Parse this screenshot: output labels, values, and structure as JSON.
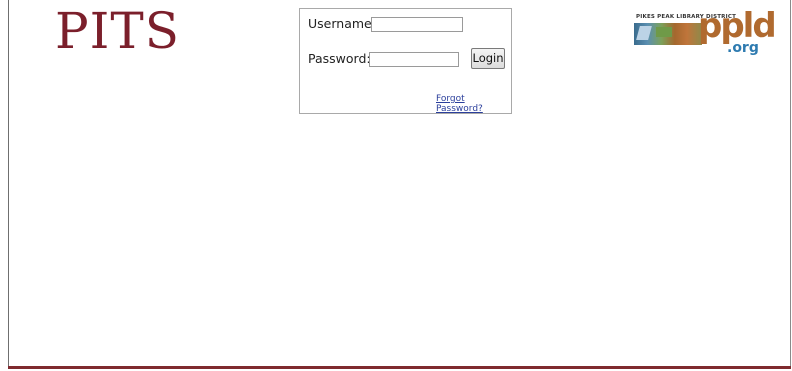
{
  "header": {
    "logo_text": "PITS",
    "partner_logo": {
      "small_text": "PIKES PEAK LIBRARY DISTRICT",
      "big_text": "ppld",
      "sub_text": ".org"
    }
  },
  "login": {
    "username_label": "Username:",
    "username_value": "",
    "password_label": "Password:",
    "password_value": "",
    "login_button": "Login",
    "forgot_link": "Forgot Password?"
  },
  "colors": {
    "brand_maroon": "#7b1f2b",
    "link_blue": "#2b3f9c",
    "ppld_orange": "#b06a2f",
    "ppld_blue": "#2e7bb0"
  }
}
